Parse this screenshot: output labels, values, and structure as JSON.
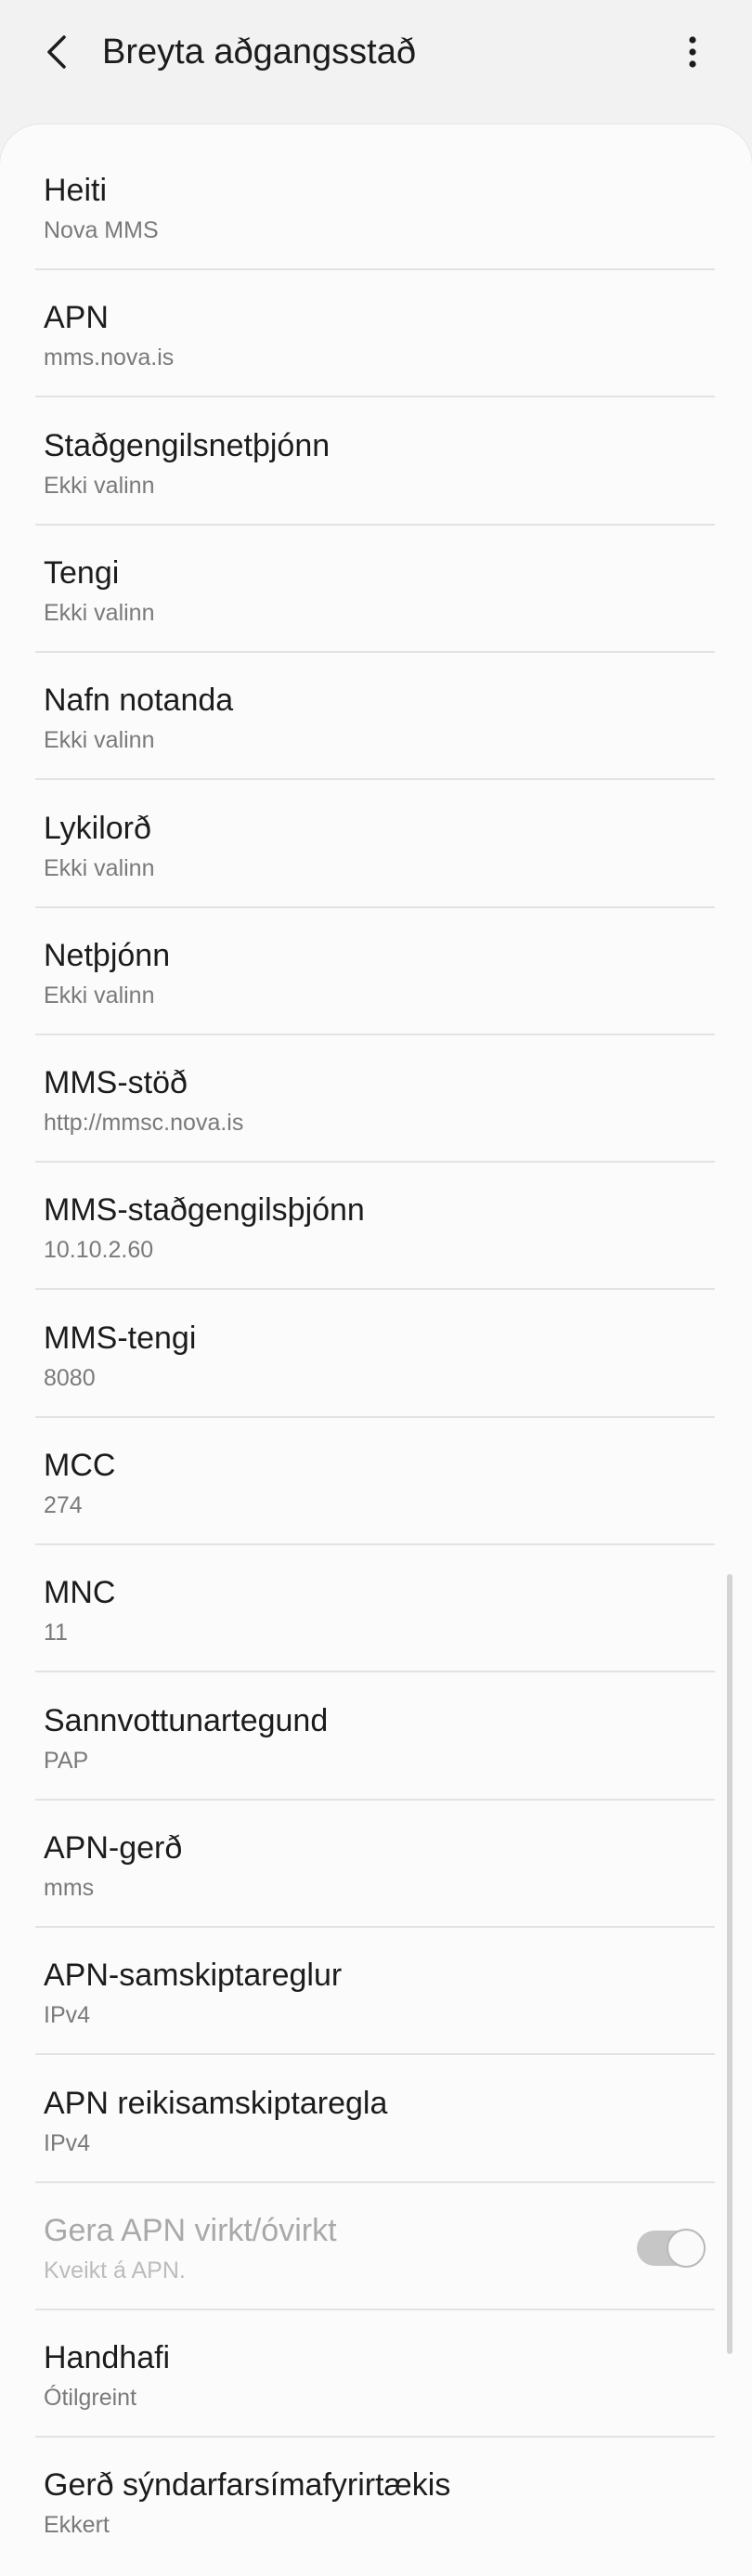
{
  "header": {
    "title": "Breyta aðgangsstað",
    "back_icon": "chevron-left-icon",
    "more_icon": "more-vertical-icon"
  },
  "fields": [
    {
      "key": "heiti",
      "label": "Heiti",
      "value": "Nova MMS"
    },
    {
      "key": "apn",
      "label": "APN",
      "value": "mms.nova.is"
    },
    {
      "key": "proxy",
      "label": "Staðgengilsnetþjónn",
      "value": "Ekki valinn"
    },
    {
      "key": "port",
      "label": "Tengi",
      "value": "Ekki valinn"
    },
    {
      "key": "username",
      "label": "Nafn notanda",
      "value": "Ekki valinn"
    },
    {
      "key": "password",
      "label": "Lykilorð",
      "value": "Ekki valinn"
    },
    {
      "key": "server",
      "label": "Netþjónn",
      "value": "Ekki valinn"
    },
    {
      "key": "mmsc",
      "label": "MMS-stöð",
      "value": "http://mmsc.nova.is"
    },
    {
      "key": "mms-proxy",
      "label": "MMS-staðgengilsþjónn",
      "value": "10.10.2.60"
    },
    {
      "key": "mms-port",
      "label": "MMS-tengi",
      "value": "8080"
    },
    {
      "key": "mcc",
      "label": "MCC",
      "value": "274"
    },
    {
      "key": "mnc",
      "label": "MNC",
      "value": "11"
    },
    {
      "key": "auth-type",
      "label": "Sannvottunartegund",
      "value": "PAP"
    },
    {
      "key": "apn-type",
      "label": "APN-gerð",
      "value": "mms"
    },
    {
      "key": "apn-protocol",
      "label": "APN-samskiptareglur",
      "value": "IPv4"
    },
    {
      "key": "apn-roaming",
      "label": "APN reikisamskiptaregla",
      "value": "IPv4"
    },
    {
      "key": "apn-enable",
      "label": "Gera APN virkt/óvirkt",
      "value": "Kveikt á APN.",
      "toggle": true,
      "toggle_on": true,
      "disabled": true
    },
    {
      "key": "bearer",
      "label": "Handhafi",
      "value": "Ótilgreint"
    },
    {
      "key": "mvno-type",
      "label": "Gerð sýndarfarsímafyrirtækis",
      "value": "Ekkert"
    }
  ],
  "colors": {
    "background": "#f2f2f2",
    "card": "#fbfbfb",
    "divider": "#e3e3e3",
    "title_text": "#1c1c1c",
    "sub_text": "#7a7a7a"
  }
}
